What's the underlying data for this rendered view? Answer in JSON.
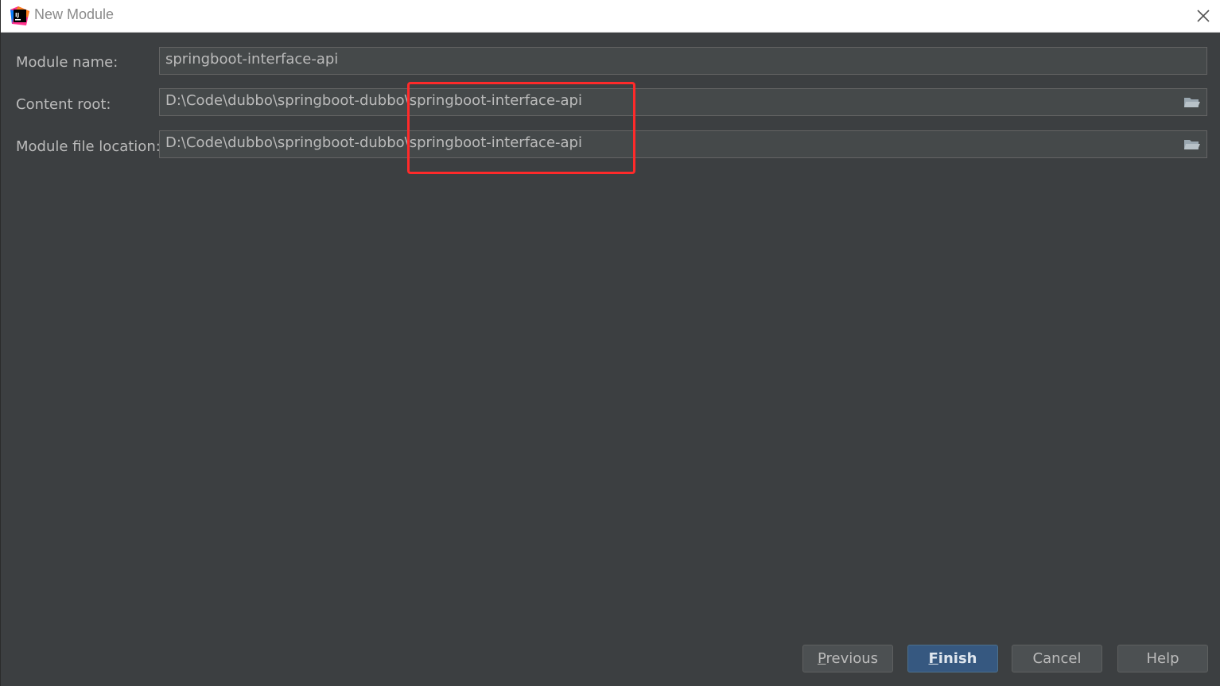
{
  "window": {
    "title": "New Module",
    "app_icon": "intellij-idea-icon",
    "close_icon": "close-icon"
  },
  "form": {
    "module_name": {
      "label": "Module name:",
      "value": "springboot-interface-api"
    },
    "content_root": {
      "label": "Content root:",
      "value": "D:\\Code\\dubbo\\springboot-dubbo\\springboot-interface-api",
      "browse_icon": "folder-icon"
    },
    "module_file_location": {
      "label": "Module file location:",
      "value": "D:\\Code\\dubbo\\springboot-dubbo\\springboot-interface-api",
      "browse_icon": "folder-icon"
    }
  },
  "annotation": {
    "color": "#ff2a2a"
  },
  "buttons": {
    "previous_mnemonic": "P",
    "previous_rest": "revious",
    "finish_mnemonic": "F",
    "finish_rest": "inish",
    "cancel": "Cancel",
    "help": "Help"
  },
  "colors": {
    "background": "#3c3f41",
    "field_background": "#45494a",
    "primary_button": "#365880",
    "text": "#bbbbbb"
  }
}
